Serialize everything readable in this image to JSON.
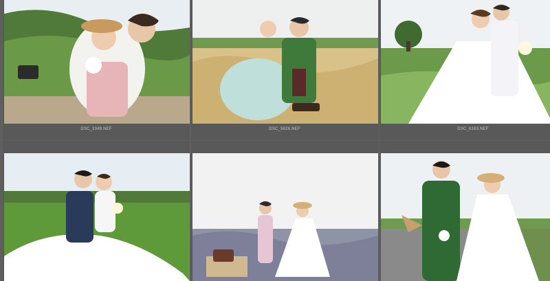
{
  "grid": {
    "cells": [
      {
        "filename": "DSC_3349.NEF"
      },
      {
        "filename": "DSC_5626.NEF"
      },
      {
        "filename": "DSC_6163.NEF"
      },
      {
        "filename": ""
      },
      {
        "filename": ""
      },
      {
        "filename": ""
      }
    ]
  },
  "colors": {
    "background": "#5f5f5f",
    "caption_text": "#c8c8c8"
  }
}
